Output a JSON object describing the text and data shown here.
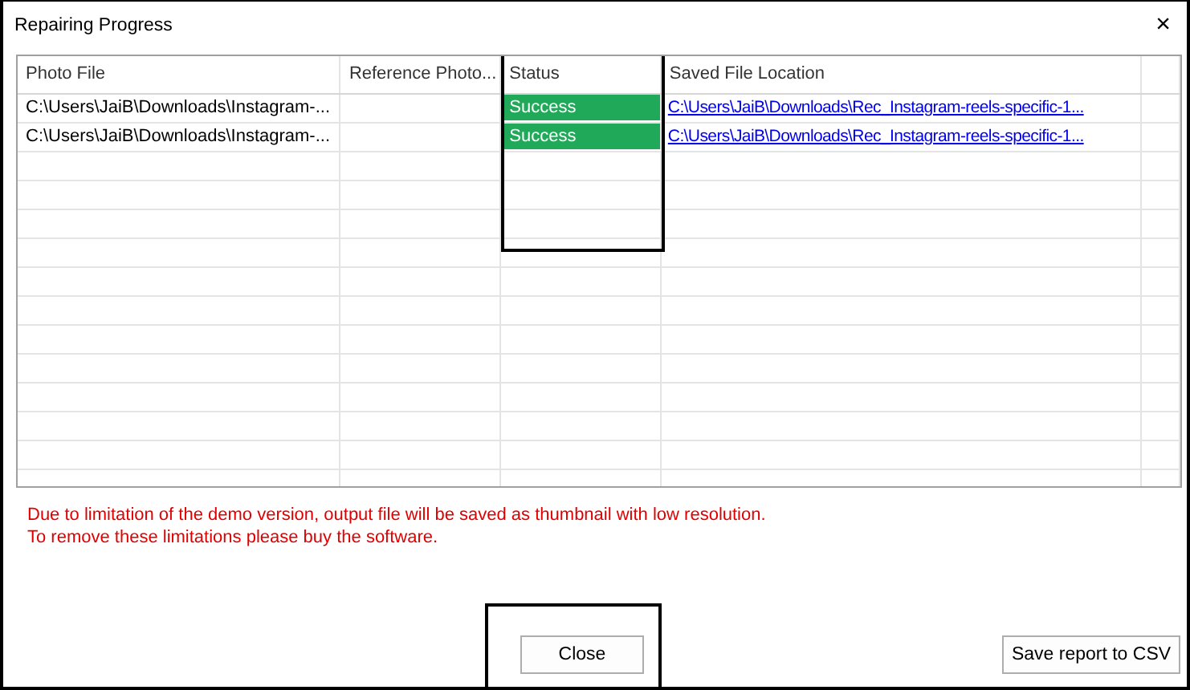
{
  "window": {
    "title": "Repairing Progress",
    "close_glyph": "×"
  },
  "table": {
    "columns": [
      {
        "label": "Photo File",
        "highlighted": false
      },
      {
        "label": "Reference Photo...",
        "highlighted": false
      },
      {
        "label": "Status",
        "highlighted": true
      },
      {
        "label": "Saved File Location",
        "highlighted": false
      }
    ],
    "rows": [
      {
        "photo_file": "C:\\Users\\JaiB\\Downloads\\Instagram-...",
        "status": "Success",
        "saved_location": "C:\\Users\\JaiB\\Downloads\\Rec_Instagram-reels-specific-1..."
      },
      {
        "photo_file": "C:\\Users\\JaiB\\Downloads\\Instagram-...",
        "status": "Success",
        "saved_location": "C:\\Users\\JaiB\\Downloads\\Rec_Instagram-reels-specific-1..."
      }
    ]
  },
  "notice": [
    "Due to limitation of the demo version, output file will be saved as thumbnail with low resolution.",
    "To remove these limitations please buy the software."
  ],
  "buttons": [
    {
      "label": "Close",
      "kind": "close",
      "highlighted": true
    },
    {
      "label": "Save report to CSV",
      "kind": "export",
      "highlighted": false
    }
  ]
}
